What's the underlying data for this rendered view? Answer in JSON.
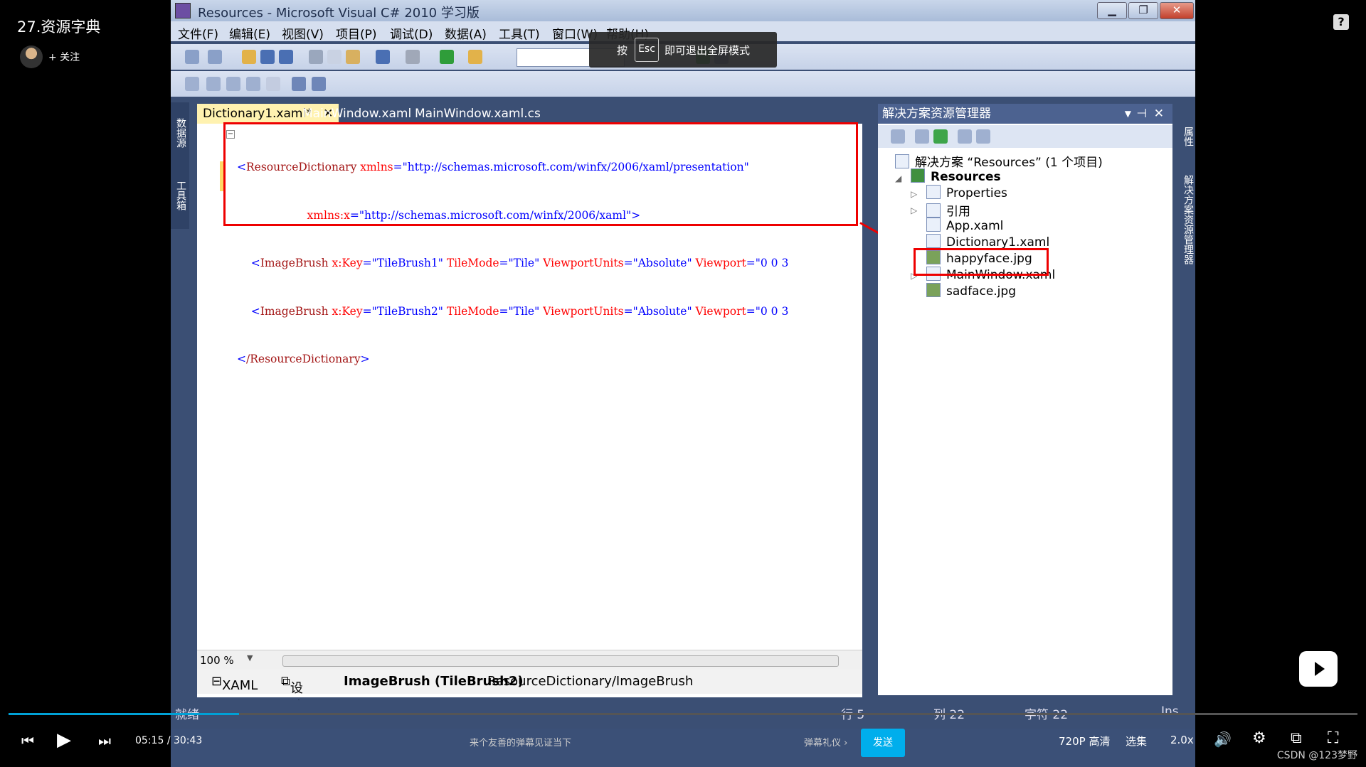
{
  "video": {
    "title": "27.资源字典",
    "follow": "+ 关注",
    "help": "?",
    "time_current": "05:15",
    "time_sep": "/",
    "time_total": "30:43",
    "progress_fraction": 0.171,
    "danmu_placeholder": "来个友善的弹幕见证当下",
    "danmu_etiquette": "弹幕礼仪 ›",
    "send_label": "发送",
    "quality": "720P 高清",
    "episodes": "选集",
    "speed": "2.0x",
    "esc_prefix": "按",
    "esc_key": "Esc",
    "esc_suffix": "即可退出全屏模式",
    "watermark": "CSDN @123梦野"
  },
  "window": {
    "title": "Resources - Microsoft Visual C# 2010 学习版",
    "menus": [
      "文件(F)",
      "编辑(E)",
      "视图(V)",
      "项目(P)",
      "调试(D)",
      "数据(A)",
      "工具(T)",
      "窗口(W)",
      "帮助(H)"
    ]
  },
  "left_strip": {
    "top": "数据源",
    "bottom": "工具箱"
  },
  "right_strip": {
    "top": "属性",
    "bottom": "解决方案资源管理器"
  },
  "editor": {
    "tabs": [
      {
        "label": "Dictionary1.xaml*",
        "active": true,
        "close": "✕"
      },
      {
        "label": "MainWindow.xaml",
        "active": false
      },
      {
        "label": "MainWindow.xaml.cs",
        "active": false
      }
    ],
    "collapse": "−",
    "code": [
      {
        "tag": "ResourceDictionary",
        "att1": "xmlns",
        "val1": "\"http://schemas.microsoft.com/winfx/2006/xaml/presentation\""
      },
      {
        "att1": "xmlns:x",
        "val1": "\"http://schemas.microsoft.com/winfx/2006/xaml\""
      },
      {
        "tag": "ImageBrush",
        "key": "x:Key",
        "keyval": "\"TileBrush1\"",
        "att2": "TileMode",
        "val2": "\"Tile\"",
        "att3": "ViewportUnits",
        "val3": "\"Absolute\"",
        "att4": "Viewport",
        "val4": "\"0 0 3"
      },
      {
        "tag": "ImageBrush",
        "key": "x:Key",
        "keyval": "\"TileBrush2\"",
        "att2": "TileMode",
        "val2": "\"Tile\"",
        "att3": "ViewportUnits",
        "val3": "\"Absolute\"",
        "att4": "Viewport",
        "val4": "\"0 0 3"
      },
      {
        "tag": "/ResourceDictionary"
      }
    ],
    "zoom": "100 %",
    "view_xaml": "XAML",
    "view_design": "设计",
    "breadcrumb_element": "ImageBrush (TileBrush2)",
    "breadcrumb_path": "ResourceDictionary/ImageBrush"
  },
  "solution_explorer": {
    "header": "解决方案资源管理器",
    "solution": "解决方案 “Resources” (1 个项目)",
    "project": "Resources",
    "items": [
      "Properties",
      "引用",
      "App.xaml",
      "Dictionary1.xaml",
      "happyface.jpg",
      "MainWindow.xaml",
      "sadface.jpg"
    ]
  },
  "status": {
    "ready": "就绪",
    "line": "行 5",
    "col": "列 22",
    "char": "字符 22",
    "mode": "Ins"
  }
}
